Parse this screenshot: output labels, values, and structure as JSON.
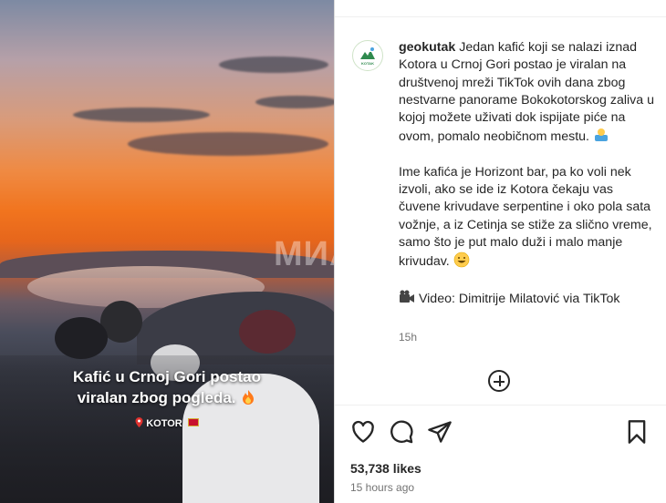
{
  "media": {
    "watermark": "МИА",
    "overlay_caption_line1": "Kafić u Crnoj Gori postao",
    "overlay_caption_line2": "viralan zbog pogleda.",
    "location": "KOTOR",
    "icons": [
      "fire-icon",
      "pin-icon",
      "flag-icon"
    ]
  },
  "post": {
    "username": "geokutak",
    "avatar_text": "KOTAK",
    "paragraph1": "Jedan kafić koji se nalazi iznad Kotora u Crnoj Gori postao je viralan na društvenoj mreži TikTok ovih dana zbog nestvarne panorame Bokokotorskog zaliva u kojoj možete uživati dok ispijate piće na ovom, pomalo neobičnom mestu.",
    "paragraph2": "Ime kafića je Horizont bar, pa ko voli nek izvoli, ako se ide iz Kotora čekaju vas čuvene krivudave serpentine i oko pola sata vožnje, a iz Cetinja se stiže za slično vreme, samo što je put malo duži i malo manje krivudav.",
    "paragraph3": "Video: Dimitrije Milatović via TikTok",
    "comment_time": "15h",
    "likes": "53,738 likes",
    "posted_ago": "15 hours ago"
  },
  "icons": {
    "like": "heart-icon",
    "comment": "comment-icon",
    "share": "send-icon",
    "save": "bookmark-icon",
    "add_comment": "plus-circle-icon"
  },
  "colors": {
    "text": "#262626",
    "muted": "#737373",
    "divider": "#dbdbdb"
  }
}
